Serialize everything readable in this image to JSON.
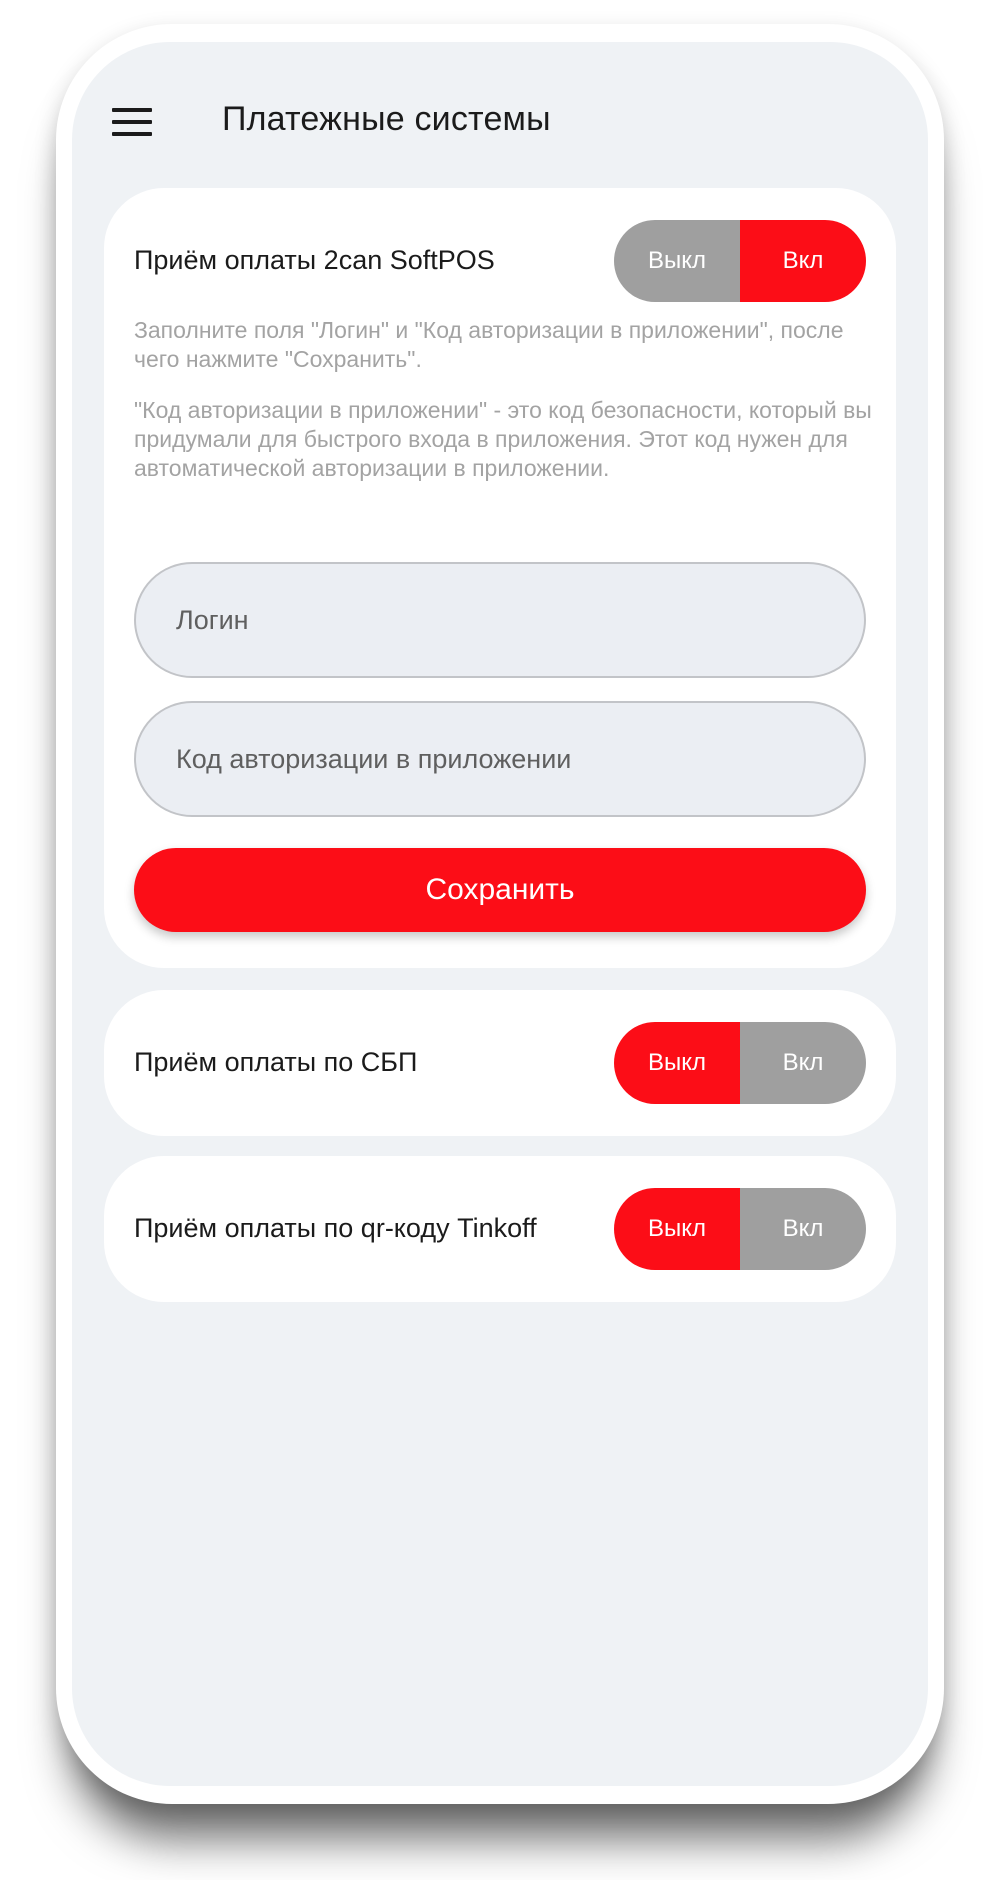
{
  "header": {
    "title": "Платежные системы",
    "menu_icon": "hamburger-menu-icon"
  },
  "softpos": {
    "title": "Приём оплаты 2can SoftPOS",
    "toggle": {
      "off_label": "Выкл",
      "on_label": "Вкл",
      "selected": "on"
    },
    "hint1": "Заполните поля \"Логин\" и \"Код авторизации в приложении\", после чего нажмите \"Сохранить\".",
    "hint2": "\"Код авторизации в приложении\" - это код безопасности, который вы придумали для быстрого входа в приложения. Этот код нужен для автоматической авторизации в приложении.",
    "login": {
      "value": "",
      "placeholder": "Логин"
    },
    "code": {
      "value": "",
      "placeholder": "Код авторизации в приложении"
    },
    "save_label": "Сохранить"
  },
  "sbp": {
    "title": "Приём оплаты по СБП",
    "toggle": {
      "off_label": "Выкл",
      "on_label": "Вкл",
      "selected": "off"
    }
  },
  "qr": {
    "title": "Приём оплаты по qr-коду Tinkoff",
    "toggle": {
      "off_label": "Выкл",
      "on_label": "Вкл",
      "selected": "off"
    }
  },
  "colors": {
    "accent": "#fc0d17",
    "inactive": "#9f9f9f",
    "background": "#eff2f5",
    "hint_text": "#a3a3a3"
  }
}
